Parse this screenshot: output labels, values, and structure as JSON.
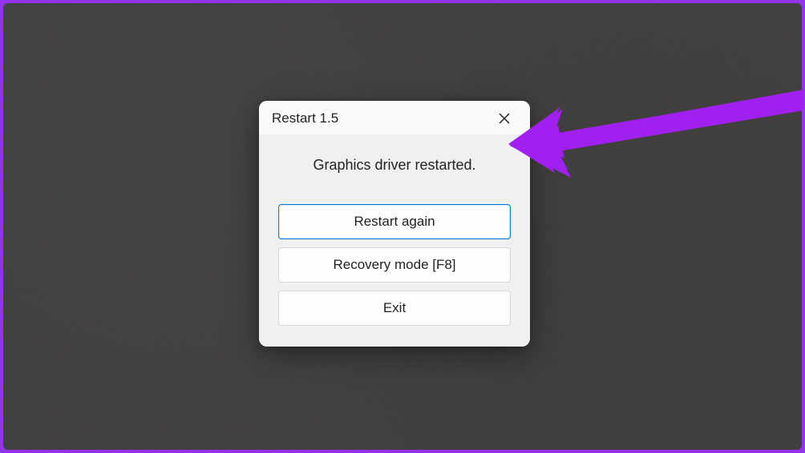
{
  "dialog": {
    "title": "Restart 1.5",
    "message": "Graphics driver restarted.",
    "buttons": {
      "restart": "Restart again",
      "recovery": "Recovery mode [F8]",
      "exit": "Exit"
    }
  },
  "annotation": {
    "arrow_color": "#a020f0"
  }
}
